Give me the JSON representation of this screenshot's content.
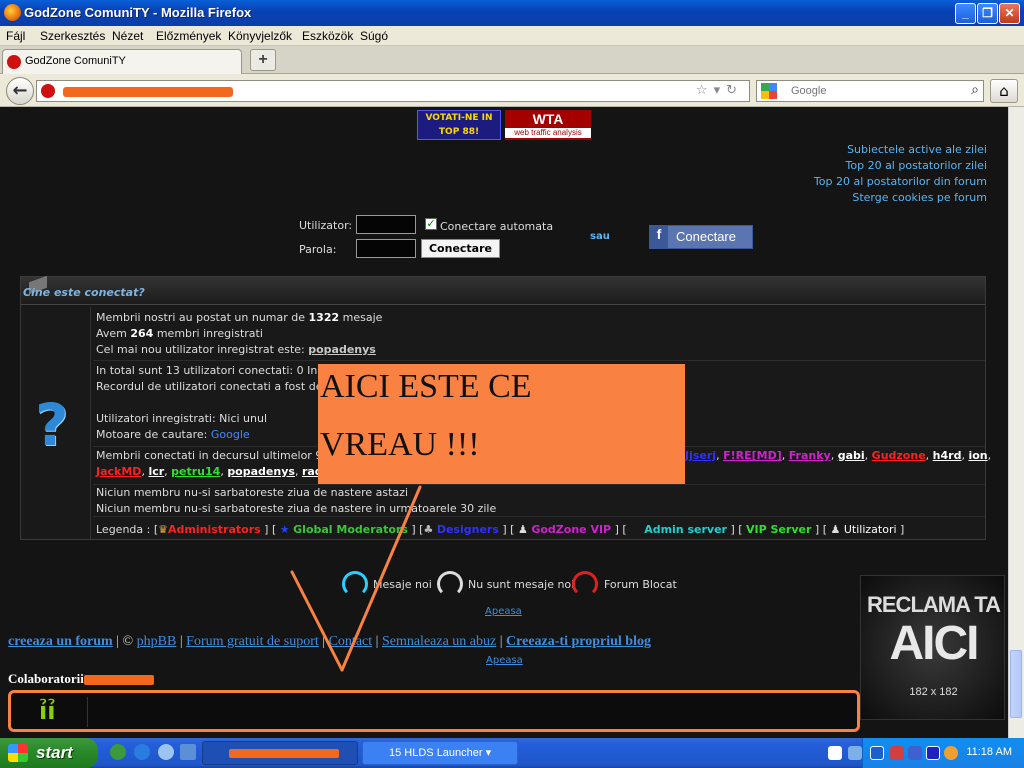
{
  "window": {
    "title": "GodZone ComuniTY - Mozilla Firefox",
    "controls": [
      "_",
      "❐",
      "✕"
    ]
  },
  "menu": [
    "Fájl",
    "Szerkesztés",
    "Nézet",
    "Előzmények",
    "Könyvjelzők",
    "Eszközök",
    "Súgó"
  ],
  "tab": {
    "label": "GodZone ComuniTY",
    "new_tab": "+"
  },
  "nav": {
    "back": "←",
    "search_placeholder": "Google",
    "home": "⌂"
  },
  "banners": {
    "votati": "VOTATI-NE IN TOP 88!",
    "wta": "WTA",
    "wta_sub": "web traffic analysis"
  },
  "right_links": [
    "Subiectele active ale zilei",
    "Top 20 al postatorilor zilei",
    "Top 20 al postatorilor din forum",
    "Sterge cookies pe forum"
  ],
  "login": {
    "username_label": "Utilizator:",
    "password_label": "Parola:",
    "auto_login": "Conectare automata",
    "submit": "Conectare",
    "or": "sau",
    "facebook": "Conectare"
  },
  "who": {
    "title": "Cine este conectat?",
    "posts_pre": "Membrii nostri au postat un numar de ",
    "posts_count": "1322",
    "posts_post": " mesaje",
    "members_pre": "Avem ",
    "members_count": "264",
    "members_post": " membri inregistrati",
    "newest_pre": "Cel mai nou utilizator inregistrat este: ",
    "newest_user": "popadenys",
    "online_line": "In total sunt 13 utilizatori conectati: 0 Inreg",
    "online_count": "13",
    "record_line": "Recordul de utilizatori conectati a fost de 10",
    "registered": "Utilizatori inregistrati: Nici unul",
    "engines_label": "Motoare de cautare: ",
    "engine": "Google",
    "last24": "Membrii conectati in decursul ultimelor 99 or",
    "users_right": [
      {
        "name": "Jjserj",
        "color": "blu"
      },
      {
        "name": "F!RE[MD]",
        "color": "pur"
      },
      {
        "name": "Franky",
        "color": "pur"
      },
      {
        "name": "gabi",
        "color": "white"
      },
      {
        "name": "Gudzone",
        "color": "red"
      },
      {
        "name": "h4rd",
        "color": "white"
      },
      {
        "name": "ion",
        "color": "white"
      }
    ],
    "users_left": [
      {
        "name": "JackMD",
        "color": "red"
      },
      {
        "name": "lcr",
        "color": "white"
      },
      {
        "name": "petru14",
        "color": "lgreen"
      },
      {
        "name": "popadenys",
        "color": "white"
      },
      {
        "name": "radu67",
        "color": "white"
      }
    ],
    "bday_today": "Niciun membru nu-si sarbatoreste ziua de nastere astazi",
    "bday_next": "Niciun membru nu-si sarbatoreste ziua de nastere in urmatoarele 30 zile",
    "legend_label": "Legenda : [",
    "legend": [
      {
        "name": "Administrators",
        "color": "red"
      },
      {
        "name": "Global Moderators",
        "color": "grn"
      },
      {
        "name": "Designers",
        "color": "blu"
      },
      {
        "name": "GodZone VIP",
        "color": "pur"
      },
      {
        "name": "Admin server",
        "color": "cyan"
      },
      {
        "name": "VIP Server",
        "color": "lgreen"
      },
      {
        "name": "Utilizatori",
        "color": "white"
      }
    ]
  },
  "overlay": {
    "line1": "AICI ESTE CE",
    "line2": "VREAU !!!"
  },
  "status_legend": {
    "new": "Mesaje noi",
    "nonew": "Nu sunt mesaje noi",
    "locked": "Forum Blocat",
    "apeasa": "Apeasa"
  },
  "footer": {
    "links": [
      "creeaza un forum",
      "phpBB",
      "Forum gratuit de suport",
      "Contact",
      "Semnaleaza un abuz",
      "Creeaza-ti propriul blog"
    ],
    "copyright": "©",
    "apeasa": "Apeasa"
  },
  "colab_title": "Colaboratorii",
  "ad": {
    "line1": "RECLAMA TA",
    "line2": "AICI",
    "size": "182 x 182"
  },
  "taskbar": {
    "start": "start",
    "task_launcher": "15 HLDS Launcher",
    "clock": "11:18 AM"
  }
}
